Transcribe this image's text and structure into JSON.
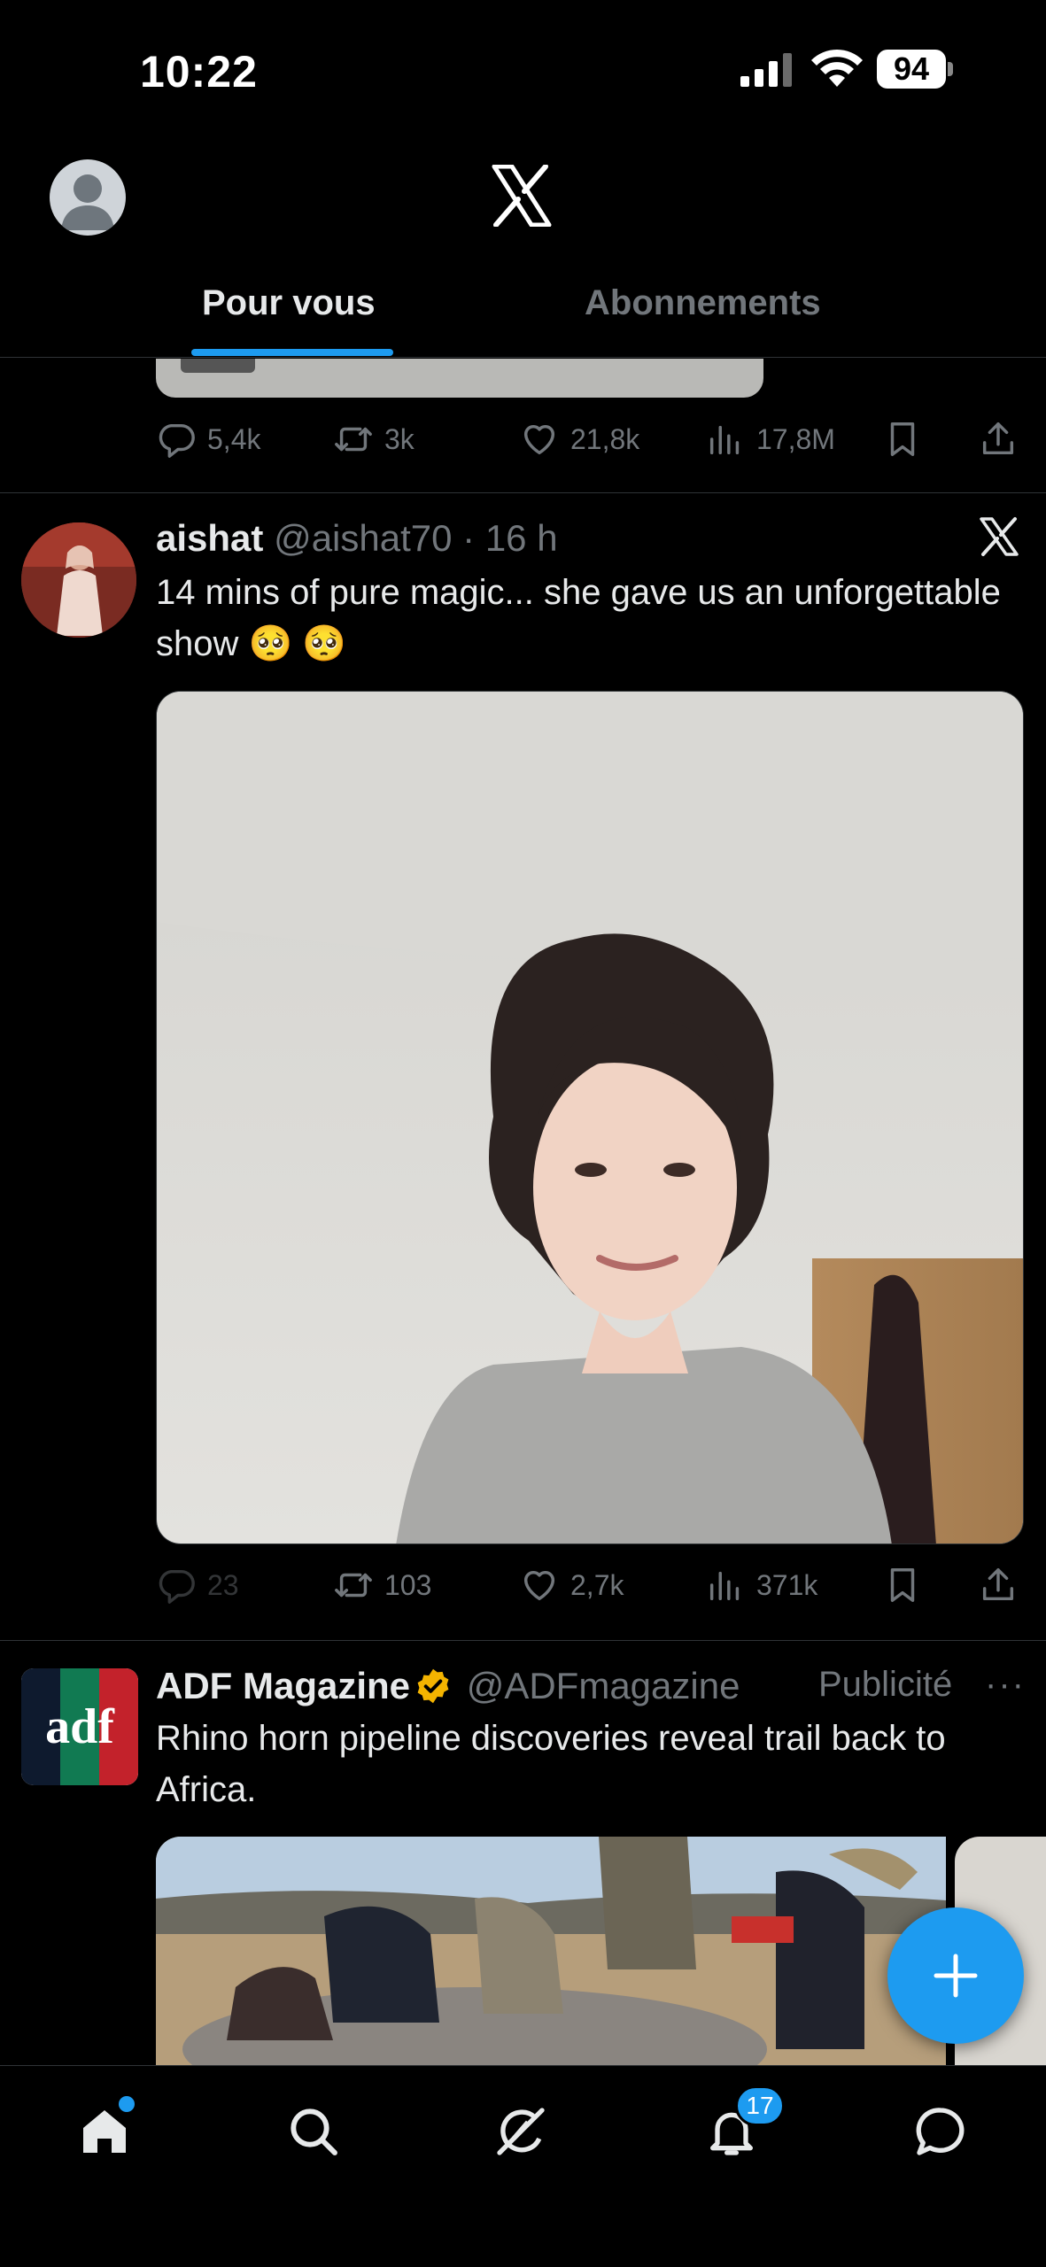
{
  "status_bar": {
    "time": "10:22",
    "battery": "94"
  },
  "header": {
    "logo": "x-logo-icon"
  },
  "tabs": [
    {
      "label": "Pour vous",
      "active": true
    },
    {
      "label": "Abonnements",
      "active": false
    }
  ],
  "previous_tweet": {
    "actions": {
      "replies": "5,4k",
      "reposts": "3k",
      "likes": "21,8k",
      "views": "17,8M"
    }
  },
  "tweet_aishat": {
    "name": "aishat",
    "handle": "@aishat70",
    "time": "· 16 h",
    "text": "14 mins of pure magic... she gave us an unforgettable show 🥺 🥺",
    "actions": {
      "replies": "23",
      "reposts": "103",
      "likes": "2,7k",
      "views": "371k"
    }
  },
  "tweet_adf": {
    "name": "ADF Magazine",
    "handle": "@ADFmagazine",
    "label": "Publicité",
    "more": "···",
    "logo_text": "adf",
    "text": "Rhino horn pipeline discoveries reveal trail back to Africa."
  },
  "bottom_nav": {
    "notifications_badge": "17"
  },
  "colors": {
    "accent": "#1d9bf0",
    "background": "#000000",
    "muted": "#71767b",
    "verified": "#f4b400"
  }
}
